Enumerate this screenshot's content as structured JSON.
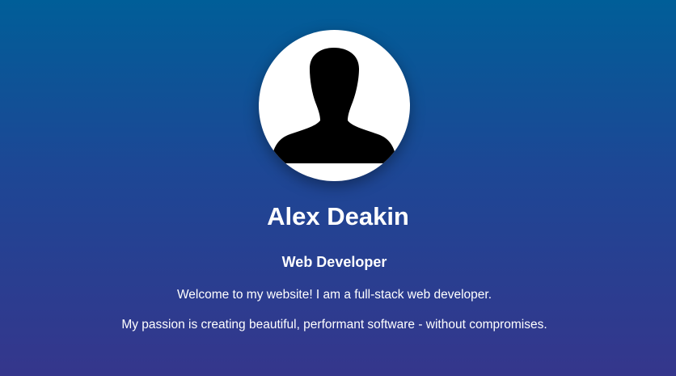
{
  "profile": {
    "avatar_icon": "person-silhouette-icon",
    "name": "Alex Deakin",
    "role": "Web Developer",
    "welcome_text": "Welcome to my website! I am a full-stack web developer.",
    "passion_text": "My passion is creating beautiful, performant software - without compromises."
  },
  "colors": {
    "background_top": "#005e98",
    "background_bottom": "#35368c",
    "text": "#ffffff",
    "avatar_background": "#ffffff",
    "silhouette": "#000000"
  }
}
